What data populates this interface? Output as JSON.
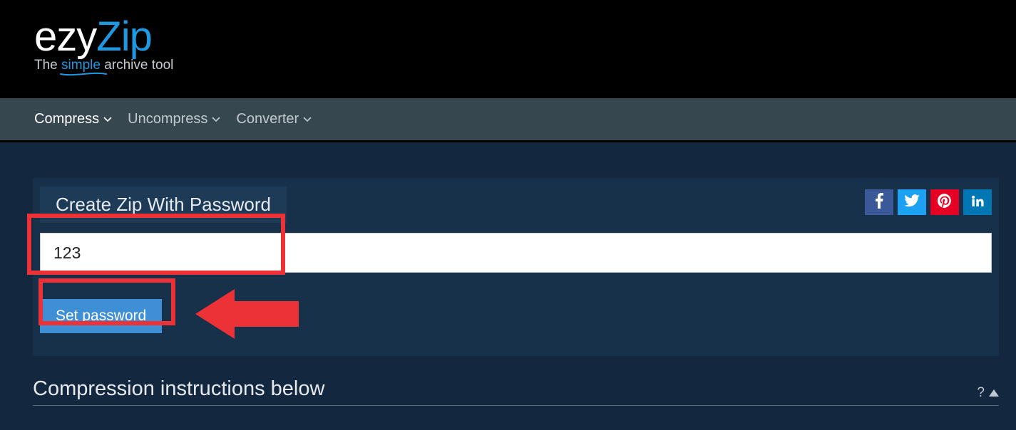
{
  "logo": {
    "part1": "ezy",
    "part2": "Zip"
  },
  "tagline": {
    "pre": "The ",
    "simple": "simple",
    "post": " archive tool"
  },
  "nav": {
    "items": [
      {
        "label": "Compress"
      },
      {
        "label": "Uncompress"
      },
      {
        "label": "Converter"
      }
    ]
  },
  "card": {
    "title": "Create Zip With Password",
    "input_value": "123",
    "button_label": "Set password"
  },
  "instructions": {
    "title": "Compression instructions below",
    "help": "?"
  }
}
